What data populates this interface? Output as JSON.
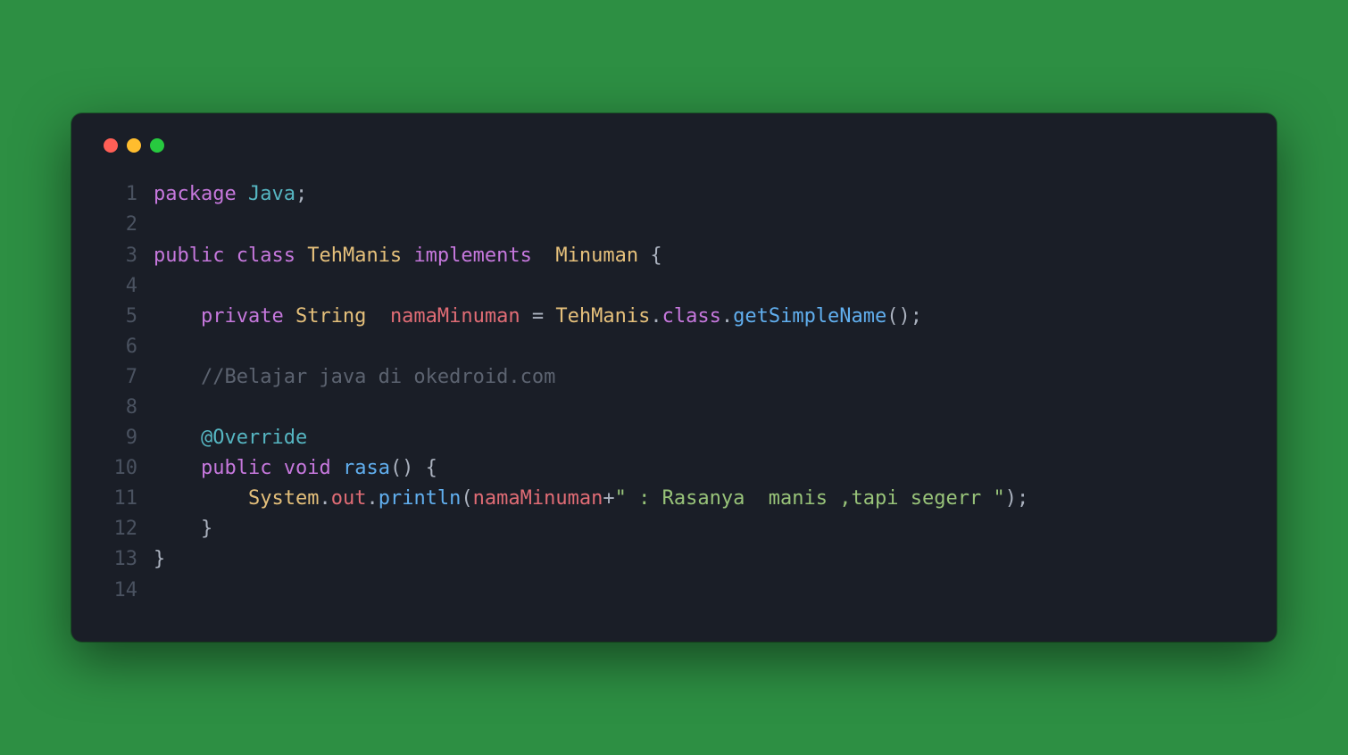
{
  "window": {
    "controls": [
      "close",
      "minimize",
      "zoom"
    ]
  },
  "code": {
    "lines": [
      {
        "n": 1,
        "tokens": [
          {
            "t": "package",
            "c": "kw"
          },
          {
            "t": " ",
            "c": "plain"
          },
          {
            "t": "Java",
            "c": "ident"
          },
          {
            "t": ";",
            "c": "punct"
          }
        ]
      },
      {
        "n": 2,
        "tokens": [
          {
            "t": "",
            "c": "plain"
          }
        ]
      },
      {
        "n": 3,
        "tokens": [
          {
            "t": "public",
            "c": "kw"
          },
          {
            "t": " ",
            "c": "plain"
          },
          {
            "t": "class",
            "c": "kw"
          },
          {
            "t": " ",
            "c": "plain"
          },
          {
            "t": "TehManis",
            "c": "type"
          },
          {
            "t": " ",
            "c": "plain"
          },
          {
            "t": "implements",
            "c": "kw"
          },
          {
            "t": "  ",
            "c": "plain"
          },
          {
            "t": "Minuman",
            "c": "type"
          },
          {
            "t": " ",
            "c": "plain"
          },
          {
            "t": "{",
            "c": "punct"
          }
        ]
      },
      {
        "n": 4,
        "tokens": [
          {
            "t": "",
            "c": "plain"
          }
        ]
      },
      {
        "n": 5,
        "tokens": [
          {
            "t": "    ",
            "c": "plain"
          },
          {
            "t": "private",
            "c": "kw"
          },
          {
            "t": " ",
            "c": "plain"
          },
          {
            "t": "String",
            "c": "type"
          },
          {
            "t": "  ",
            "c": "plain"
          },
          {
            "t": "namaMinuman",
            "c": "var"
          },
          {
            "t": " ",
            "c": "plain"
          },
          {
            "t": "=",
            "c": "punct"
          },
          {
            "t": " ",
            "c": "plain"
          },
          {
            "t": "TehManis",
            "c": "type"
          },
          {
            "t": ".",
            "c": "dot-p"
          },
          {
            "t": "class",
            "c": "kw"
          },
          {
            "t": ".",
            "c": "dot-p"
          },
          {
            "t": "getSimpleName",
            "c": "method"
          },
          {
            "t": "();",
            "c": "punct"
          }
        ]
      },
      {
        "n": 6,
        "tokens": [
          {
            "t": "",
            "c": "plain"
          }
        ]
      },
      {
        "n": 7,
        "tokens": [
          {
            "t": "    ",
            "c": "plain"
          },
          {
            "t": "//Belajar java di okedroid.com",
            "c": "comment"
          }
        ]
      },
      {
        "n": 8,
        "tokens": [
          {
            "t": "",
            "c": "plain"
          }
        ]
      },
      {
        "n": 9,
        "tokens": [
          {
            "t": "    ",
            "c": "plain"
          },
          {
            "t": "@Override",
            "c": "anno"
          }
        ]
      },
      {
        "n": 10,
        "tokens": [
          {
            "t": "    ",
            "c": "plain"
          },
          {
            "t": "public",
            "c": "kw"
          },
          {
            "t": " ",
            "c": "plain"
          },
          {
            "t": "void",
            "c": "kw"
          },
          {
            "t": " ",
            "c": "plain"
          },
          {
            "t": "rasa",
            "c": "method"
          },
          {
            "t": "() {",
            "c": "punct"
          }
        ]
      },
      {
        "n": 11,
        "tokens": [
          {
            "t": "        ",
            "c": "plain"
          },
          {
            "t": "System",
            "c": "type"
          },
          {
            "t": ".",
            "c": "dot-p"
          },
          {
            "t": "out",
            "c": "var"
          },
          {
            "t": ".",
            "c": "dot-p"
          },
          {
            "t": "println",
            "c": "method"
          },
          {
            "t": "(",
            "c": "punct"
          },
          {
            "t": "namaMinuman",
            "c": "var"
          },
          {
            "t": "+",
            "c": "punct"
          },
          {
            "t": "\" : Rasanya  manis ,tapi segerr \"",
            "c": "str"
          },
          {
            "t": ");",
            "c": "punct"
          }
        ]
      },
      {
        "n": 12,
        "tokens": [
          {
            "t": "    ",
            "c": "plain"
          },
          {
            "t": "}",
            "c": "punct"
          }
        ]
      },
      {
        "n": 13,
        "tokens": [
          {
            "t": "}",
            "c": "punct"
          }
        ]
      },
      {
        "n": 14,
        "tokens": [
          {
            "t": "",
            "c": "plain"
          }
        ]
      }
    ]
  }
}
